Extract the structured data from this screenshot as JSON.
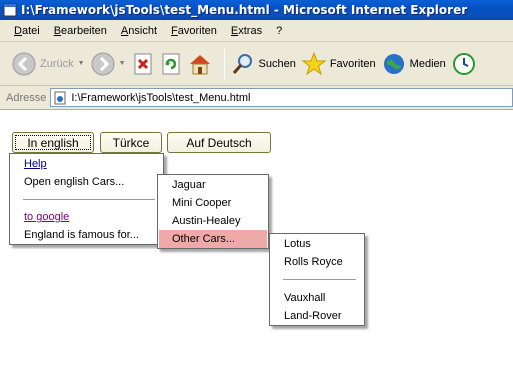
{
  "window": {
    "title": "I:\\Framework\\jsTools\\test_Menu.html - Microsoft Internet Explorer"
  },
  "menubar": {
    "items": [
      "Datei",
      "Bearbeiten",
      "Ansicht",
      "Favoriten",
      "Extras",
      "?"
    ]
  },
  "toolbar": {
    "back_label": "Zurück",
    "search_label": "Suchen",
    "favorites_label": "Favoriten",
    "media_label": "Medien"
  },
  "address": {
    "label": "Adresse",
    "value": "I:\\Framework\\jsTools\\test_Menu.html"
  },
  "languages": {
    "english": "In english",
    "turkish": "Türkce",
    "german": "Auf Deutsch"
  },
  "menus": {
    "main": {
      "help": "Help",
      "open_english_cars": "Open english Cars...",
      "to_google": "to google",
      "england_famous": "England is famous for..."
    },
    "cars": {
      "jaguar": "Jaguar",
      "mini_cooper": "Mini Cooper",
      "austin_healey": "Austin-Healey",
      "other_cars": "Other Cars..."
    },
    "other": {
      "lotus": "Lotus",
      "rolls_royce": "Rolls Royce",
      "vauxhall": "Vauxhall",
      "land_rover": "Land-Rover"
    }
  },
  "colors": {
    "titlebar": "#0550c0",
    "chrome": "#ece9d8",
    "menu_highlight": "#f0a9a9",
    "link": "#00008b",
    "visited_link": "#800080"
  }
}
